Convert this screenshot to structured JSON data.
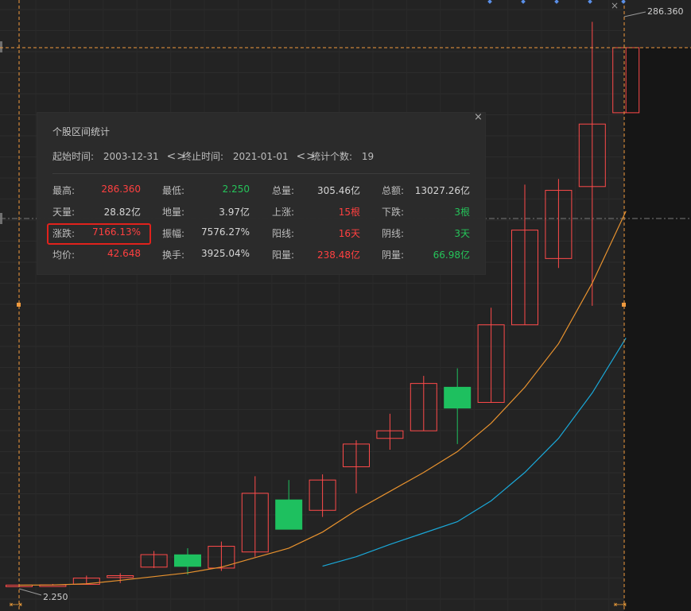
{
  "chart_data": {
    "type": "candlestick",
    "price_max_label": "286.360",
    "price_min_label": "2.250",
    "ylim": [
      2.25,
      286.36
    ],
    "candles": [
      {
        "o": 2.35,
        "c": 2.5,
        "h": 3.0,
        "l": 2.25
      },
      {
        "o": 2.4,
        "c": 2.6,
        "h": 3.1,
        "l": 2.3
      },
      {
        "o": 2.9,
        "c": 6.2,
        "h": 7.5,
        "l": 2.7
      },
      {
        "o": 6.5,
        "c": 7.5,
        "h": 8.8,
        "l": 3.6
      },
      {
        "o": 12.0,
        "c": 18.6,
        "h": 20.5,
        "l": 11.5
      },
      {
        "o": 18.5,
        "c": 12.4,
        "h": 22.0,
        "l": 8.0
      },
      {
        "o": 11.5,
        "c": 23.0,
        "h": 25.5,
        "l": 10.0
      },
      {
        "o": 20.0,
        "c": 51.0,
        "h": 60.0,
        "l": 17.5
      },
      {
        "o": 47.5,
        "c": 32.0,
        "h": 58.0,
        "l": 32.0
      },
      {
        "o": 42.0,
        "c": 58.0,
        "h": 61.0,
        "l": 38.5
      },
      {
        "o": 65.0,
        "c": 77.0,
        "h": 79.0,
        "l": 51.0
      },
      {
        "o": 80.0,
        "c": 84.0,
        "h": 93.0,
        "l": 74.0
      },
      {
        "o": 84.0,
        "c": 109.0,
        "h": 113.0,
        "l": 84.0
      },
      {
        "o": 107.0,
        "c": 96.0,
        "h": 117.0,
        "l": 77.0
      },
      {
        "o": 99.0,
        "c": 140.0,
        "h": 149.0,
        "l": 99.0
      },
      {
        "o": 140.0,
        "c": 190.0,
        "h": 214.0,
        "l": 140.0
      },
      {
        "o": 175.0,
        "c": 211.0,
        "h": 217.0,
        "l": 170.0
      },
      {
        "o": 213.0,
        "c": 246.0,
        "h": 300.0,
        "l": 150.0
      },
      {
        "o": 252.0,
        "c": 286.36,
        "h": 286.36,
        "l": 252.0
      }
    ],
    "ma_orange": [
      2.45,
      2.6,
      3.2,
      5.0,
      7.0,
      9.0,
      12.0,
      17.0,
      22.0,
      30.5,
      42.0,
      52.0,
      62.0,
      73.0,
      88.0,
      107.0,
      130.0,
      162.0,
      200.0
    ],
    "ma_blue": [
      null,
      null,
      null,
      null,
      null,
      null,
      null,
      null,
      null,
      12.5,
      17.5,
      24.0,
      30.0,
      36.0,
      47.0,
      62.0,
      80.0,
      104.0,
      133.0
    ],
    "colors": {
      "up": "#ff4a4a",
      "down": "#1ec05f",
      "ma_orange": "#e8922e",
      "ma_blue": "#1aa8d8",
      "crosshair": "#f09a3e"
    }
  },
  "panel": {
    "title": "个股区间统计",
    "start_label": "起始时间:",
    "start_value": "2003-12-31",
    "end_label": "终止时间:",
    "end_value": "2021-01-01",
    "count_label": "统计个数:",
    "count_value": "19",
    "arrows": "<>",
    "close": "×",
    "rows": [
      [
        {
          "label": "最高:",
          "value": "286.360",
          "color": "red"
        },
        {
          "label": "最低:",
          "value": "2.250",
          "color": "green"
        },
        {
          "label": "总量:",
          "value": "305.46亿",
          "color": "white"
        },
        {
          "label": "总额:",
          "value": "13027.26亿",
          "color": "white"
        }
      ],
      [
        {
          "label": "天量:",
          "value": "28.82亿",
          "color": "white"
        },
        {
          "label": "地量:",
          "value": "3.97亿",
          "color": "white"
        },
        {
          "label": "上涨:",
          "value": "15根",
          "color": "red"
        },
        {
          "label": "下跌:",
          "value": "3根",
          "color": "green"
        }
      ],
      [
        {
          "label": "涨跌:",
          "value": "7166.13%",
          "color": "red"
        },
        {
          "label": "振幅:",
          "value": "7576.27%",
          "color": "white"
        },
        {
          "label": "阳线:",
          "value": "16天",
          "color": "red"
        },
        {
          "label": "阴线:",
          "value": "3天",
          "color": "green"
        }
      ],
      [
        {
          "label": "均价:",
          "value": "42.648",
          "color": "red"
        },
        {
          "label": "换手:",
          "value": "3925.04%",
          "color": "white"
        },
        {
          "label": "阳量:",
          "value": "238.48亿",
          "color": "red"
        },
        {
          "label": "阴量:",
          "value": "66.98亿",
          "color": "green"
        }
      ]
    ]
  },
  "chart_close": "×",
  "scroll_left": "⇤⇥",
  "scroll_right": "⇤⇥"
}
